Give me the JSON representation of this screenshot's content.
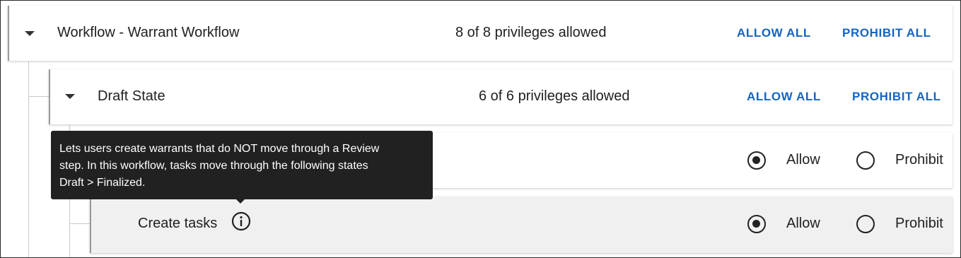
{
  "workflow": {
    "title": "Workflow - Warrant Workflow",
    "count": "8 of 8 privileges allowed",
    "allow_all": "ALLOW ALL",
    "prohibit_all": "PROHIBIT ALL"
  },
  "state": {
    "title": "Draft State",
    "count": "6 of 6 privileges allowed",
    "allow_all": "ALLOW ALL",
    "prohibit_all": "PROHIBIT ALL"
  },
  "privileges": [
    {
      "label": "",
      "allow_label": "Allow",
      "prohibit_label": "Prohibit",
      "selected": "allow"
    },
    {
      "label": "Create tasks",
      "allow_label": "Allow",
      "prohibit_label": "Prohibit",
      "selected": "allow"
    }
  ],
  "tooltip": {
    "line1": "Lets users create warrants that do NOT move through a Review",
    "line2": "step. In this workflow, tasks move through the following states",
    "line3": "Draft > Finalized."
  },
  "colors": {
    "link": "#1565c0",
    "tooltip_bg": "#212121",
    "highlight_row": "#f0f0f0"
  },
  "icons": {
    "expand": "caret-down-icon",
    "info": "info-circle-icon"
  }
}
